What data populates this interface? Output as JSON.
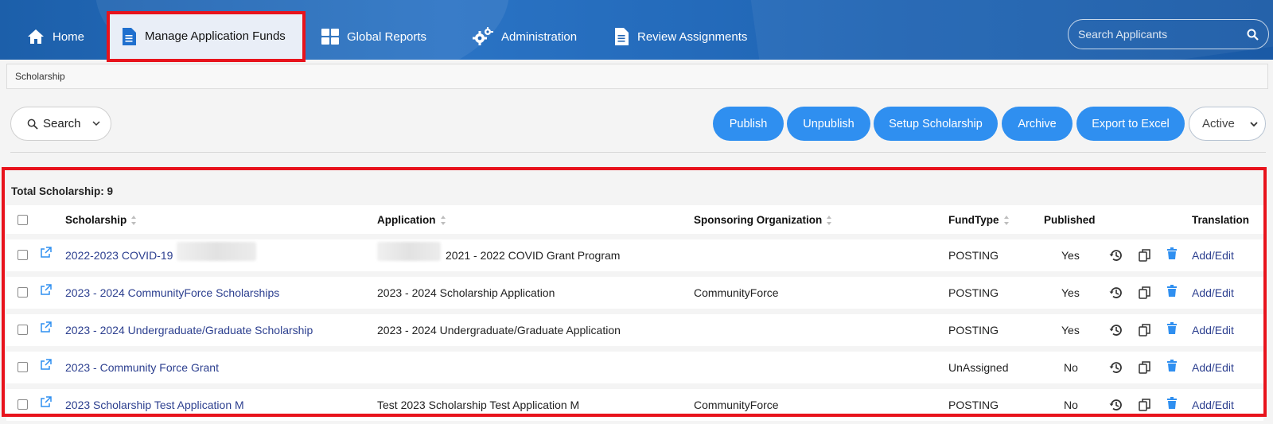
{
  "nav": {
    "home_label": "Home",
    "manage_label": "Manage Application Funds",
    "reports_label": "Global Reports",
    "admin_label": "Administration",
    "review_label": "Review Assignments",
    "search_placeholder": "Search Applicants"
  },
  "breadcrumb": "Scholarship",
  "toolbar": {
    "search_label": "Search",
    "publish_label": "Publish",
    "unpublish_label": "Unpublish",
    "setup_label": "Setup Scholarship",
    "archive_label": "Archive",
    "export_label": "Export to Excel",
    "status_value": "Active"
  },
  "table": {
    "total_label": "Total Scholarship: 9",
    "headers": {
      "scholarship": "Scholarship",
      "application": "Application",
      "sponsor": "Sponsoring Organization",
      "fundtype": "FundType",
      "published": "Published",
      "translation": "Translation"
    },
    "rows": [
      {
        "scholarship": "2022-2023 COVID-19",
        "application": "2021 - 2022 COVID Grant Program",
        "sponsor": "",
        "fundtype": "POSTING",
        "published": "Yes",
        "translation": "Add/Edit"
      },
      {
        "scholarship": "2023 - 2024 CommunityForce Scholarships",
        "application": "2023 - 2024 Scholarship Application",
        "sponsor": "CommunityForce",
        "fundtype": "POSTING",
        "published": "Yes",
        "translation": "Add/Edit"
      },
      {
        "scholarship": "2023 - 2024 Undergraduate/Graduate Scholarship",
        "application": "2023 - 2024 Undergraduate/Graduate Application",
        "sponsor": "",
        "fundtype": "POSTING",
        "published": "Yes",
        "translation": "Add/Edit"
      },
      {
        "scholarship": "2023 - Community Force Grant",
        "application": "",
        "sponsor": "",
        "fundtype": "UnAssigned",
        "published": "No",
        "translation": "Add/Edit"
      },
      {
        "scholarship": "2023 Scholarship Test Application M",
        "application": "Test 2023 Scholarship Test Application M",
        "sponsor": "CommunityForce",
        "fundtype": "POSTING",
        "published": "No",
        "translation": "Add/Edit"
      }
    ]
  },
  "colors": {
    "nav_blue": "#1f64b3",
    "button_blue": "#2f8ff0",
    "highlight_red": "#e8131c",
    "link": "#2c3f8f"
  }
}
